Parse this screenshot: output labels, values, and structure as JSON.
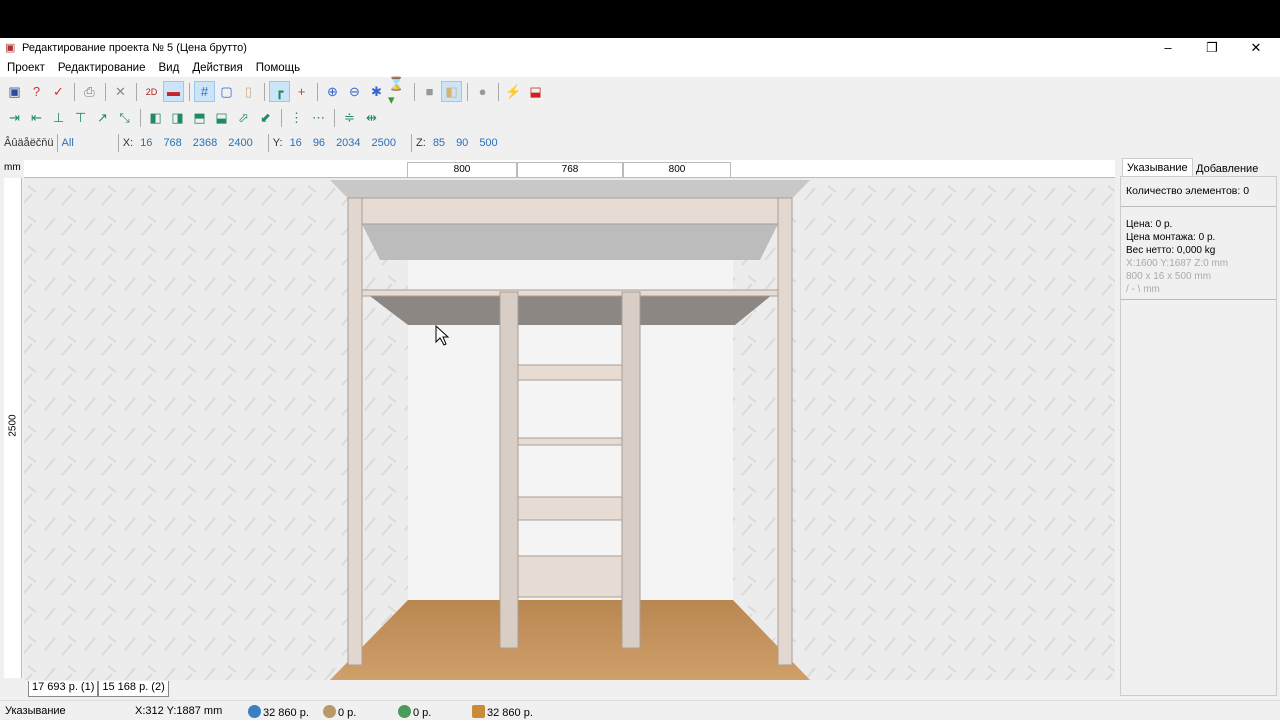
{
  "window": {
    "title": "Редактирование проекта № 5 (Цена брутто)"
  },
  "menu": [
    "Проект",
    "Редактирование",
    "Вид",
    "Действия",
    "Помощь"
  ],
  "toolbar1": [
    "save-icon",
    "help-icon",
    "check-icon",
    "print-icon",
    "delete-icon",
    "view-2d-icon",
    "view-front-icon",
    "grid-icon",
    "frame-icon",
    "door-icon",
    "corner-icon",
    "cross-icon",
    "zoom-in-icon",
    "zoom-out-icon",
    "fit-icon",
    "render-icon",
    "solid-icon",
    "texture-icon",
    "sphere-icon",
    "magic-icon",
    "tool-icon"
  ],
  "filter": {
    "label": "Âûäåëčňü",
    "value": "All",
    "x_label": "X:",
    "x_values": [
      "16",
      "768",
      "2368",
      "2400"
    ],
    "y_label": "Y:",
    "y_values": [
      "16",
      "96",
      "2034",
      "2500"
    ],
    "z_label": "Z:",
    "z_values": [
      "85",
      "90",
      "500"
    ]
  },
  "ruler": {
    "unit": "mm",
    "segments": [
      "800",
      "768",
      "800"
    ],
    "height": "2500"
  },
  "panel": {
    "tabs": [
      "Указывание",
      "Добавление"
    ],
    "count": "Количество элементов: 0",
    "price": "Цена:  0 р.",
    "install": "Цена монтажа:  0 р.",
    "weight": "Вес нетто:  0,000 kg",
    "coords": "X:1600  Y:1687  Z:0 mm",
    "size": "800 x 16 x 500 mm",
    "angle": "/ - \\ mm"
  },
  "bottom_tabs": [
    "17 693 р. (1)",
    "15 168 р. (2)"
  ],
  "status": {
    "mode": "Указывание",
    "cursor": "X:312  Y:1887  mm",
    "total": "32 860 р.",
    "material": "0 р.",
    "services": "0 р.",
    "sum": "32 860 р."
  },
  "colors": {
    "floor": "#c4925a",
    "wall": "#e9e9e9",
    "panel": "#e6dcd4"
  }
}
